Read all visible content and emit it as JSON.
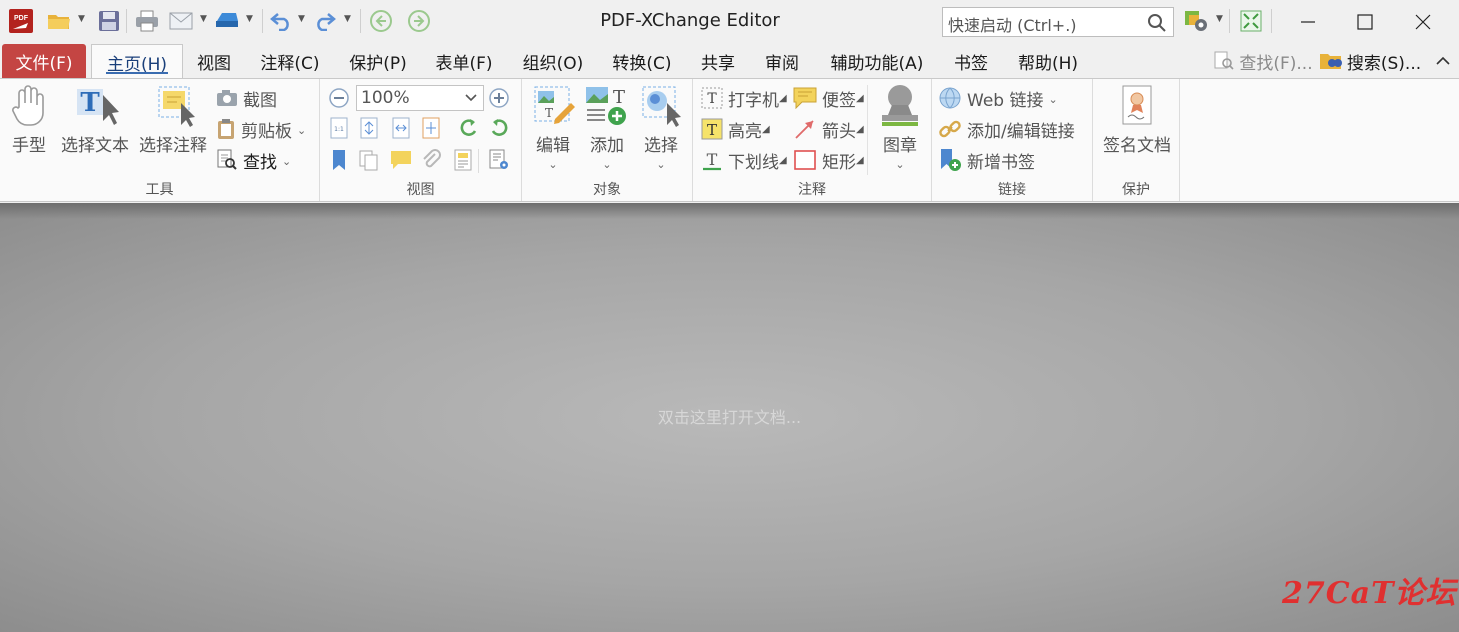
{
  "app": {
    "title": "PDF-XChange Editor",
    "logo_text": "PDF",
    "quick_launch_placeholder": "快速启动 (Ctrl+.)"
  },
  "menu": {
    "items": [
      "文件(F)",
      "主页(H)",
      "视图",
      "注释(C)",
      "保护(P)",
      "表单(F)",
      "组织(O)",
      "转换(C)",
      "共享",
      "审阅",
      "辅助功能(A)",
      "书签",
      "帮助(H)"
    ],
    "find": "查找(F)...",
    "search": "搜索(S)..."
  },
  "ribbon": {
    "tools": {
      "label": "工具",
      "hand": "手型",
      "select_text": "选择文本",
      "select_annot": "选择注释",
      "snapshot": "截图",
      "clipboard": "剪贴板",
      "find": "查找"
    },
    "view": {
      "label": "视图",
      "zoom": "100%"
    },
    "objects": {
      "label": "对象",
      "edit": "编辑",
      "add": "添加",
      "select": "选择"
    },
    "comment": {
      "label": "注释",
      "typewriter": "打字机",
      "sticky": "便签",
      "highlight": "高亮",
      "arrow": "箭头",
      "underline": "下划线",
      "rectangle": "矩形",
      "stamp": "图章"
    },
    "links": {
      "label": "链接",
      "web_links": "Web 链接",
      "add_edit_links": "添加/编辑链接",
      "add_bookmark": "新增书签"
    },
    "protect": {
      "label": "保护",
      "sign": "签名文档"
    }
  },
  "workspace": {
    "hint": "双击这里打开文档..."
  },
  "watermark": "27CaT论坛",
  "colors": {
    "file_menu": "#c44543",
    "accent_blue": "#3a6cb0",
    "workspace": "#a6a6a6"
  }
}
